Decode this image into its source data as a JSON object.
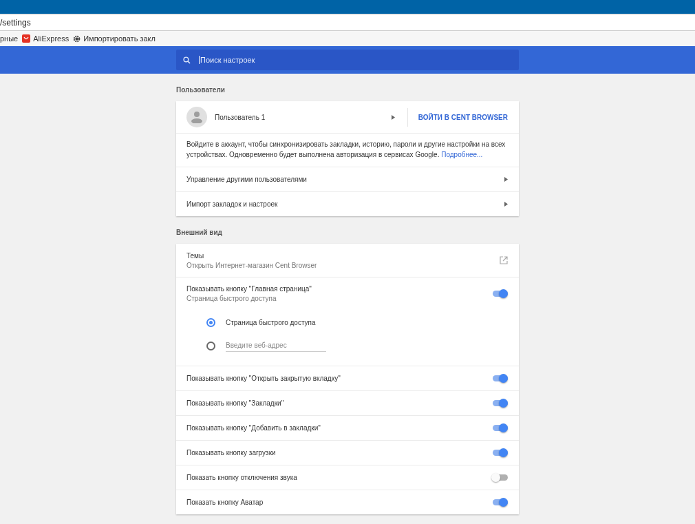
{
  "browser": {
    "address": "/settings",
    "bookmarks": [
      {
        "kind": "text",
        "label": "рные"
      },
      {
        "kind": "aliexpress",
        "label": "AliExpress"
      },
      {
        "kind": "gear",
        "label": "Импортировать закл"
      }
    ]
  },
  "search": {
    "placeholder": "Поиск настроек"
  },
  "users": {
    "heading": "Пользователи",
    "user_name": "Пользователь 1",
    "sign_in": "ВОЙТИ В CENT BROWSER",
    "description": "Войдите в аккаунт, чтобы синхронизировать закладки, историю, пароли и другие настройки на всех устройствах. Одновременно будет выполнена авторизация в сервисах Google.",
    "more_link": "Подробнее...",
    "rows": [
      {
        "label": "Управление другими пользователями"
      },
      {
        "label": "Импорт закладок и настроек"
      }
    ]
  },
  "appearance": {
    "heading": "Внешний вид",
    "themes": {
      "label": "Темы",
      "sublabel": "Открыть Интернет-магазин Cent Browser"
    },
    "home": {
      "label": "Показывать кнопку \"Главная страница\"",
      "sublabel": "Страница быстрого доступа",
      "on": true,
      "options": [
        {
          "kind": "label",
          "label": "Страница быстрого доступа",
          "selected": true
        },
        {
          "kind": "input",
          "placeholder": "Введите веб-адрес",
          "selected": false
        }
      ]
    },
    "toggles": [
      {
        "label": "Показывать кнопку \"Открыть закрытую вкладку\"",
        "on": true
      },
      {
        "label": "Показывать кнопку \"Закладки\"",
        "on": true
      },
      {
        "label": "Показывать кнопку \"Добавить в закладки\"",
        "on": true
      },
      {
        "label": "Показывать кнопку загрузки",
        "on": true
      },
      {
        "label": "Показать кнопку отключения звука",
        "on": false
      },
      {
        "label": "Показать кнопку Аватар",
        "on": true
      }
    ]
  }
}
